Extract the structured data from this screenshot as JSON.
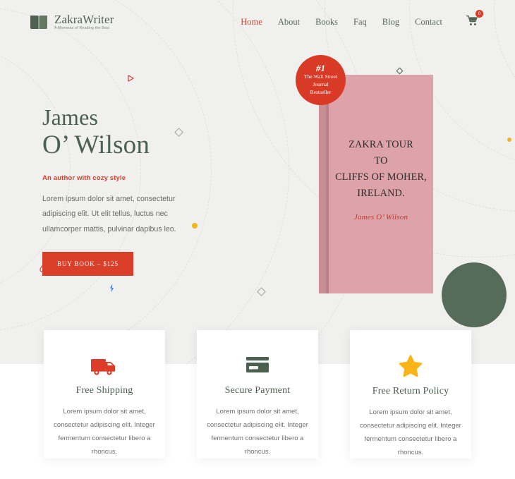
{
  "brand": {
    "name": "ZakraWriter",
    "tagline": "A Moments of Reading the Best",
    "logo_icon": "open-book-icon",
    "logo_color": "#4e6151"
  },
  "nav": {
    "items": [
      {
        "label": "Home",
        "active": true
      },
      {
        "label": "About",
        "active": false
      },
      {
        "label": "Books",
        "active": false
      },
      {
        "label": "Faq",
        "active": false
      },
      {
        "label": "Blog",
        "active": false
      },
      {
        "label": "Contact",
        "active": false
      }
    ],
    "cart": {
      "icon": "shopping-cart-icon",
      "count": "0",
      "badge_color": "#d93a26"
    }
  },
  "hero": {
    "name_line1": "James",
    "name_line2": "O’ Wilson",
    "subtitle": "An author with cozy style",
    "paragraph": "Lorem ipsum dolor sit amet, consectetur adipiscing elit. Ut elit tellus, luctus nec ullamcorper mattis, pulvinar dapibus leo.",
    "cta_label": "BUY BOOK – $125",
    "cta_color": "#d93f29",
    "heading_color": "#4c6050",
    "subtitle_color": "#dc3c28",
    "background_color": "#f0f0ee"
  },
  "book": {
    "badge": {
      "rank": "#1",
      "line1": "The Wall Street",
      "line2": "Journal",
      "line3": "Bestseller",
      "color": "#d93a26"
    },
    "title_line1": "ZAKRA TOUR",
    "title_line2": "TO",
    "title_line3": "CLIFFS OF MOHER,",
    "title_line4": "IRELAND.",
    "author": "James O’  Wilson",
    "cover_color": "#dda3a9",
    "author_color": "#c0392b",
    "accent_circle_color": "#546c59"
  },
  "features": {
    "cards": [
      {
        "icon": "delivery-truck-icon",
        "icon_color": "#dc3c28",
        "title": "Free Shipping",
        "text": "Lorem ipsum dolor sit amet, consectetur adipiscing elit. Integer fermentum consectetur libero a rhoncus."
      },
      {
        "icon": "credit-card-icon",
        "icon_color": "#4c6050",
        "title": "Secure Payment",
        "text": "Lorem ipsum dolor sit amet, consectetur adipiscing elit. Integer fermentum consectetur libero a rhoncus."
      },
      {
        "icon": "star-icon",
        "icon_color": "#fbb418",
        "title": "Free Return Policy",
        "text": "Lorem ipsum dolor sit amet, consectetur adipiscing elit. Integer fermentum consectetur libero a rhoncus."
      }
    ]
  },
  "decorations": {
    "play-triangle-icon": "#d8453a",
    "drop-icon": "#d8453a",
    "lightning-bolt-icon": "#4a86e8",
    "dot-color": "#f5b517",
    "diamond-color": "#9aa39c"
  }
}
